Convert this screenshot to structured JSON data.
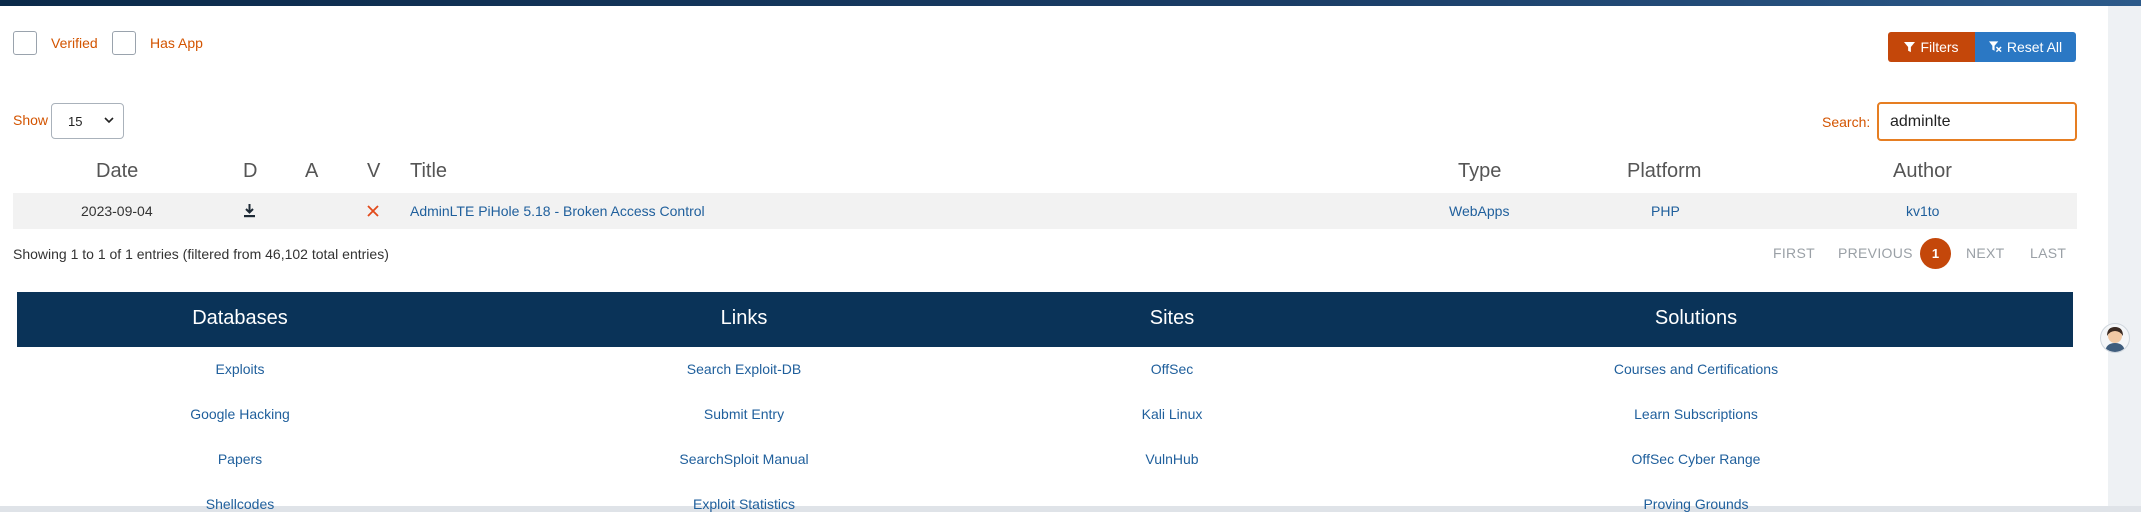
{
  "filters": {
    "verified_label": "Verified",
    "has_app_label": "Has App",
    "filters_button": "Filters",
    "reset_button": "Reset All"
  },
  "controls": {
    "show_label": "Show",
    "show_value": "15",
    "search_label": "Search:",
    "search_value": "adminlte"
  },
  "table": {
    "headers": {
      "date": "Date",
      "d": "D",
      "a": "A",
      "v": "V",
      "title": "Title",
      "type": "Type",
      "platform": "Platform",
      "author": "Author"
    },
    "rows": [
      {
        "date": "2023-09-04",
        "title": "AdminLTE PiHole 5.18 - Broken Access Control",
        "type": "WebApps",
        "platform": "PHP",
        "author": "kv1to"
      }
    ]
  },
  "info": "Showing 1 to 1 of 1 entries (filtered from 46,102 total entries)",
  "pagination": {
    "first": "FIRST",
    "previous": "PREVIOUS",
    "current": "1",
    "next": "NEXT",
    "last": "LAST"
  },
  "footer": {
    "columns": [
      {
        "heading": "Databases",
        "links": [
          "Exploits",
          "Google Hacking",
          "Papers",
          "Shellcodes"
        ]
      },
      {
        "heading": "Links",
        "links": [
          "Search Exploit-DB",
          "Submit Entry",
          "SearchSploit Manual",
          "Exploit Statistics"
        ]
      },
      {
        "heading": "Sites",
        "links": [
          "OffSec",
          "Kali Linux",
          "VulnHub"
        ]
      },
      {
        "heading": "Solutions",
        "links": [
          "Courses and Certifications",
          "Learn Subscriptions",
          "OffSec Cyber Range",
          "Proving Grounds"
        ]
      }
    ]
  },
  "colors": {
    "accent_orange": "#c4470a",
    "accent_blue": "#2b78c4",
    "link_blue": "#1f5f9c",
    "footer_navy": "#0a3358"
  }
}
